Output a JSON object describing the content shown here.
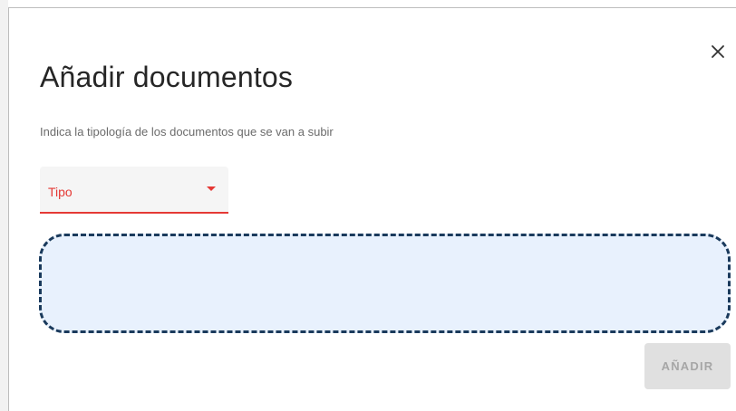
{
  "dialog": {
    "title": "Añadir documentos",
    "subtitle": "Indica la tipología de los documentos que se van a subir",
    "close_icon": "close-icon"
  },
  "type_select": {
    "label": "Tipo",
    "icon": "dropdown-arrow-icon",
    "accent_color": "#e53935"
  },
  "dropzone": {
    "background_color": "#e8f1fd",
    "border_color": "#1a3a5c"
  },
  "actions": {
    "add_label": "AÑADIR",
    "add_disabled": true
  }
}
